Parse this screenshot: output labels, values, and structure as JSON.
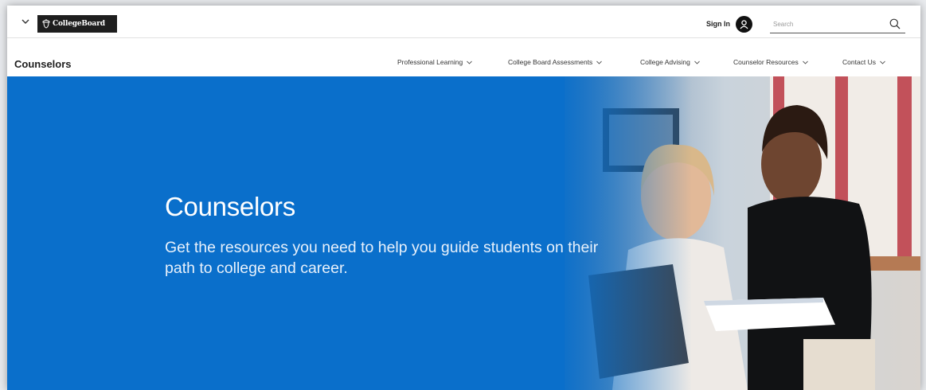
{
  "topbar": {
    "logo_text": "CollegeBoard",
    "signin_label": "Sign In",
    "search_placeholder": "Search"
  },
  "sitebar": {
    "title": "Counselors",
    "nav": [
      {
        "label": "Professional Learning"
      },
      {
        "label": "College Board Assessments"
      },
      {
        "label": "College Advising"
      },
      {
        "label": "Counselor Resources"
      },
      {
        "label": "Contact Us"
      }
    ]
  },
  "hero": {
    "title": "Counselors",
    "subtitle": "Get the resources you need to help you guide students on their path to college and career."
  },
  "colors": {
    "hero_blue": "#0a6fcb",
    "text_dark": "#1e1e1e",
    "logo_bg": "#1e1e1e"
  },
  "icons": {
    "menu": "chevron-down-icon",
    "logo": "acorn-icon",
    "account": "user-icon",
    "search": "search-icon",
    "nav_caret": "chevron-down-icon"
  }
}
